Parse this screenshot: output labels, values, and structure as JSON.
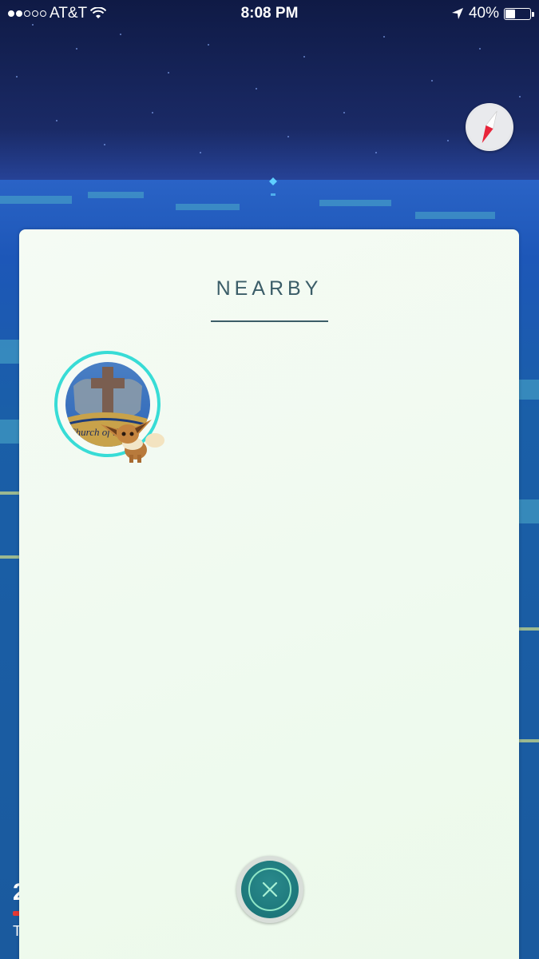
{
  "status_bar": {
    "carrier": "AT&T",
    "time": "8:08 PM",
    "battery_percent": "40%",
    "battery_level": 0.4,
    "signal_bars_filled": 2,
    "signal_bars_total": 5
  },
  "compass": {
    "icon": "compass-icon"
  },
  "nearby_panel": {
    "title": "NEARBY",
    "items": [
      {
        "icon": "pokestop-photo",
        "pokemon_icon": "eevee-icon",
        "photo_caption": "Church of the W"
      }
    ]
  },
  "close_button": {
    "icon": "close-icon"
  },
  "colors": {
    "panel_bg": "#f0f9ef",
    "title": "#3b5d68",
    "ring": "#38dcd6",
    "close_teal": "#1f7e80"
  }
}
